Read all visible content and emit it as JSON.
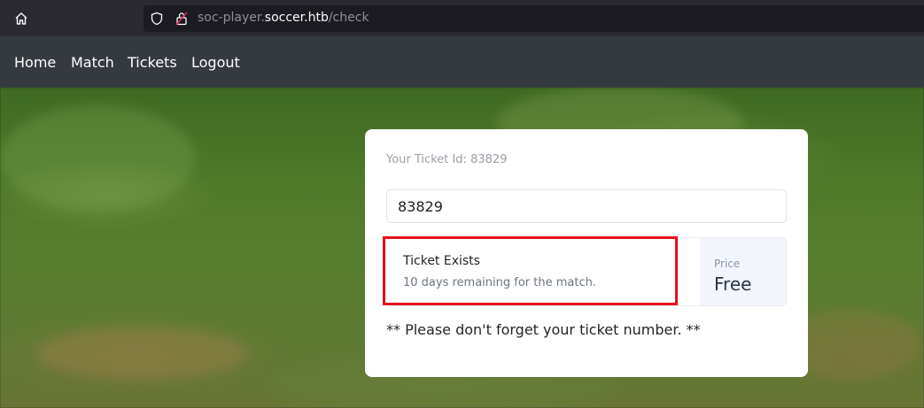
{
  "browser": {
    "url_prefix": "soc-player.",
    "url_domain": "soccer.htb",
    "url_path": "/check",
    "icons": [
      "home-icon",
      "shield-icon",
      "lock-icon"
    ]
  },
  "nav": {
    "items": [
      {
        "label": "Home"
      },
      {
        "label": "Match"
      },
      {
        "label": "Tickets"
      },
      {
        "label": "Logout"
      }
    ]
  },
  "card": {
    "ticket_label": "Your Ticket Id: 83829",
    "input_value": "83829",
    "result_title": "Ticket Exists",
    "result_subtitle": "10 days remaining for the match.",
    "price_label": "Price",
    "price_value": "Free",
    "note": "** Please don't forget your ticket number. **"
  },
  "colors": {
    "highlight_border": "#e6101a",
    "nav_bg": "#353a40",
    "price_bg": "#f2f6fc"
  }
}
